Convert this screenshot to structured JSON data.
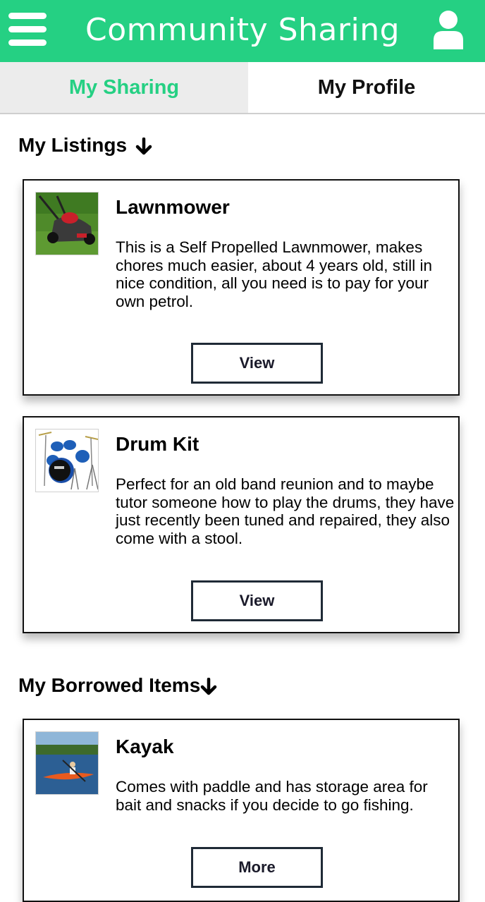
{
  "header": {
    "title": "Community Sharing",
    "menu_icon": "hamburger-menu-icon",
    "profile_icon": "user-icon",
    "accent_color": "#25d083"
  },
  "tabs": [
    {
      "label": "My Sharing",
      "active": true
    },
    {
      "label": "My Profile",
      "active": false
    }
  ],
  "listings": {
    "heading": "My Listings",
    "heading_icon": "arrow-down-icon",
    "items": [
      {
        "title": "Lawnmower",
        "description": "This is a Self Propelled Lawnmower, makes chores much easier, about 4 years old, still in nice condition, all you need is to pay for your own petrol.",
        "button_label": "View",
        "image": "lawnmower-image"
      },
      {
        "title": "Drum Kit",
        "description": "Perfect for an old band reunion and to maybe tutor someone how to play the drums, they have just recently been tuned and repaired, they also come with a stool.",
        "button_label": "View",
        "image": "drum-kit-image"
      }
    ]
  },
  "borrowed": {
    "heading": "My Borrowed Items",
    "heading_icon": "arrow-down-icon",
    "items": [
      {
        "title": "Kayak",
        "description": "Comes with paddle and has storage area for bait and snacks if you decide to go fishing.",
        "button_label": "More",
        "image": "kayak-image"
      }
    ]
  }
}
